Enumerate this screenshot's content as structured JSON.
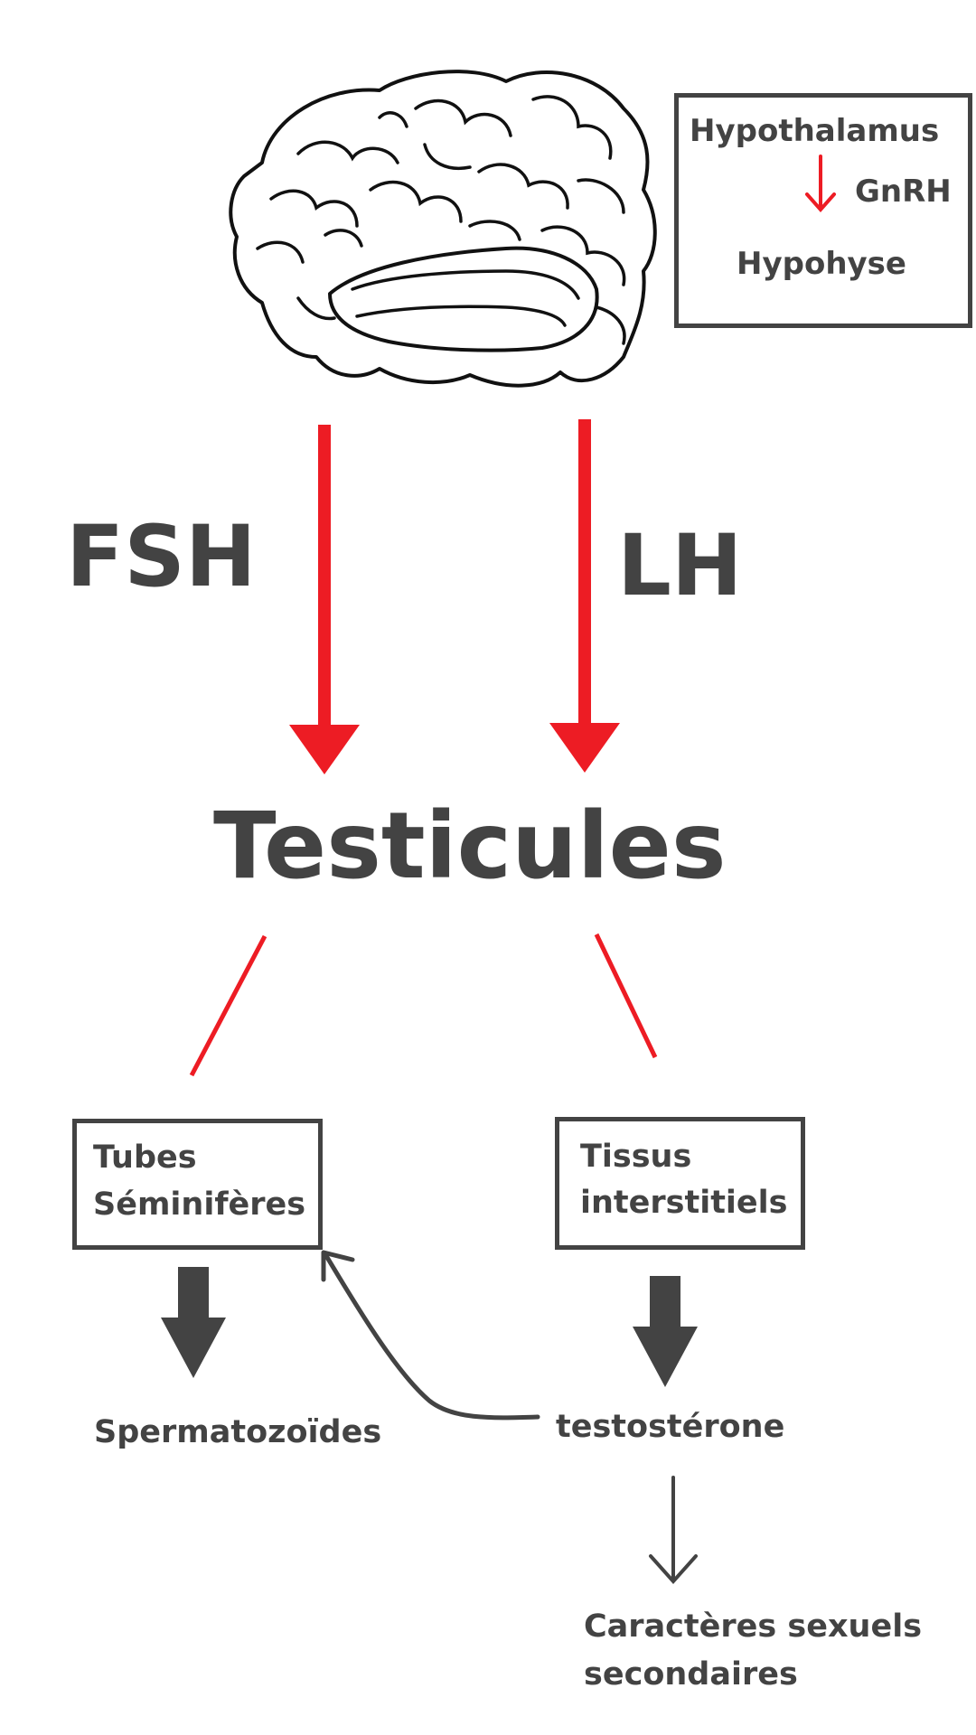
{
  "hypothalamus_box": {
    "hypothalamus": "Hypothalamus",
    "gnrh": "GnRH",
    "hypophyse": "Hypohyse"
  },
  "hormones": {
    "fsh": "FSH",
    "lh": "LH"
  },
  "center": {
    "testicules": "Testicules"
  },
  "left_branch": {
    "box_line1": "Tubes",
    "box_line2": "Séminifères",
    "output": "Spermatozoïdes"
  },
  "right_branch": {
    "box_line1": "Tissus",
    "box_line2": "interstitiels",
    "output": "testostérone",
    "effect_line1": "Caractères sexuels",
    "effect_line2": "secondaires"
  },
  "colors": {
    "red": "#ED1C24",
    "dark": "#434343"
  },
  "icons": {
    "brain": "brain-icon"
  }
}
